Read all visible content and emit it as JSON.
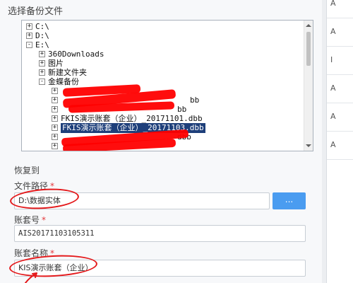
{
  "dialog": {
    "select_backup_title": "选择备份文件",
    "restore_to_title": "恢复到"
  },
  "tree": {
    "nodes": [
      {
        "label": "C:\\",
        "expander": "+"
      },
      {
        "label": "D:\\",
        "expander": "+"
      },
      {
        "label": "E:\\",
        "expander": "-"
      },
      {
        "label": "360Downloads",
        "expander": "+"
      },
      {
        "label": "图片",
        "expander": "+"
      },
      {
        "label": "新建文件夹",
        "expander": "+"
      },
      {
        "label": "金蝶备份",
        "expander": "-"
      },
      {
        "label": "",
        "expander": "+"
      },
      {
        "label": "bb",
        "expander": "+"
      },
      {
        "label": "bb",
        "expander": "+"
      },
      {
        "label": "FKIS演示账套（企业）_20171101.dbb",
        "expander": "+"
      },
      {
        "label": "FKIS演示账套（企业）_20171103.dbb",
        "expander": "+",
        "selected": true
      },
      {
        "label": "dbb",
        "expander": "+"
      },
      {
        "label": "",
        "expander": "+"
      }
    ]
  },
  "fields": {
    "file_path": {
      "label": "文件路径",
      "required_mark": "*",
      "value": "D:\\数据实体"
    },
    "account_no": {
      "label": "账套号",
      "required_mark": "*",
      "value": "AIS20171103105311"
    },
    "account_name": {
      "label": "账套名称",
      "required_mark": "*",
      "value": "KIS演示账套（企业）"
    },
    "browse_label": "..."
  },
  "right_panel": {
    "letters": [
      "A",
      "A",
      "I",
      "A",
      "A",
      "A"
    ]
  },
  "colors": {
    "accent": "#4a9cf0",
    "selection": "#1e3f7a",
    "required": "#e4393c",
    "annotation": "#e4191b"
  }
}
